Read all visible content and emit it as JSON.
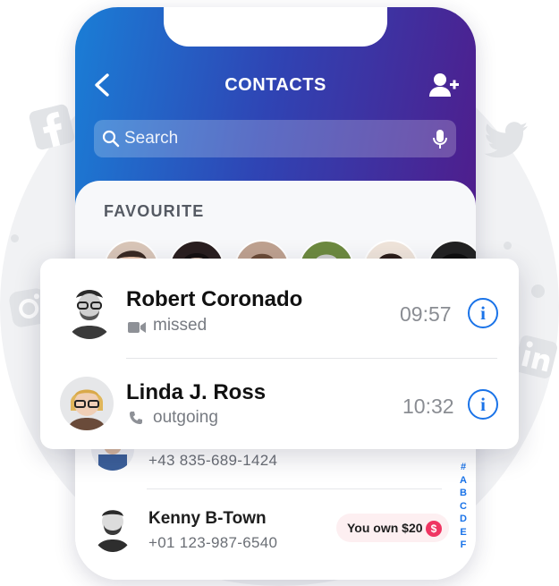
{
  "header": {
    "title": "CONTACTS",
    "back_icon": "chevron-left-icon",
    "add_icon": "add-user-icon",
    "search_placeholder": "Search"
  },
  "favourite": {
    "title": "FAVOURITE",
    "count": 6
  },
  "recent_calls": [
    {
      "name": "Robert Coronado",
      "status": "missed",
      "status_icon": "video-camera-icon",
      "time": "09:57"
    },
    {
      "name": "Linda J. Ross",
      "status": "outgoing",
      "status_icon": "phone-icon",
      "time": "10:32"
    }
  ],
  "contacts": [
    {
      "name": "",
      "phone": "+43 835-689-1424"
    },
    {
      "name": "Kenny B-Town",
      "phone": "+01 123-987-6540",
      "badge": "You own $20",
      "badge_symbol": "$"
    }
  ],
  "alphabet_index": [
    "#",
    "A",
    "B",
    "C",
    "D",
    "E",
    "F"
  ],
  "colors": {
    "accent": "#1a73e8",
    "gradient_start": "#1a7ed6",
    "gradient_end": "#4f1d8c",
    "badge_bg": "#fdeff1",
    "badge_icon": "#ef3562"
  }
}
